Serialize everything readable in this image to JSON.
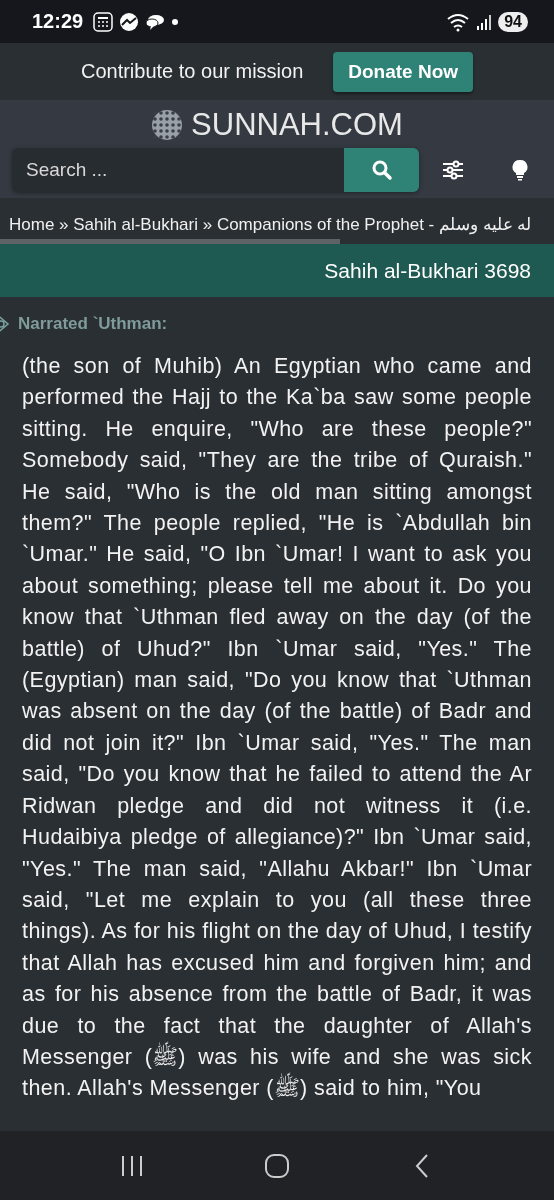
{
  "status_bar": {
    "time": "12:29",
    "battery": "94"
  },
  "banner": {
    "text": "Contribute to our mission",
    "button": "Donate Now"
  },
  "logo": {
    "text": "SUNNAH.COM"
  },
  "search": {
    "placeholder": "Search ..."
  },
  "breadcrumbs": {
    "text": "Home » Sahih al-Bukhari » Companions of the Prophet - له عليه وسلم"
  },
  "hadith": {
    "reference": "Sahih al-Bukhari 3698",
    "narrator": "Narrated `Uthman:",
    "text": "(the son of Muhib) An Egyptian who came and performed the Hajj to the Ka`ba saw some people sitting. He enquire, \"Who are these people?\" Somebody said, \"They are the tribe of Quraish.\" He said, \"Who is the old man sitting amongst them?\" The people replied, \"He is `Abdullah bin `Umar.\" He said, \"O Ibn `Umar! I want to ask you about something; please tell me about it. Do you know that `Uthman fled away on the day (of the battle) of Uhud?\" Ibn `Umar said, \"Yes.\" The (Egyptian) man said, \"Do you know that `Uthman was absent on the day (of the battle) of Badr and did not join it?\" Ibn `Umar said, \"Yes.\" The man said, \"Do you know that he failed to attend the Ar Ridwan pledge and did not witness it (i.e. Hudaibiya pledge of allegiance)?\" Ibn `Umar said, \"Yes.\" The man said, \"Allahu Akbar!\" Ibn `Umar said, \"Let me explain to you (all these three things). As for his flight on the day of Uhud, I testify that Allah has excused him and forgiven him; and as for his absence from the battle of Badr, it was due to the fact that the daughter of Allah's Messenger (ﷺ) was his wife and she was sick then. Allah's Messenger (ﷺ) said to him, \"You"
  }
}
